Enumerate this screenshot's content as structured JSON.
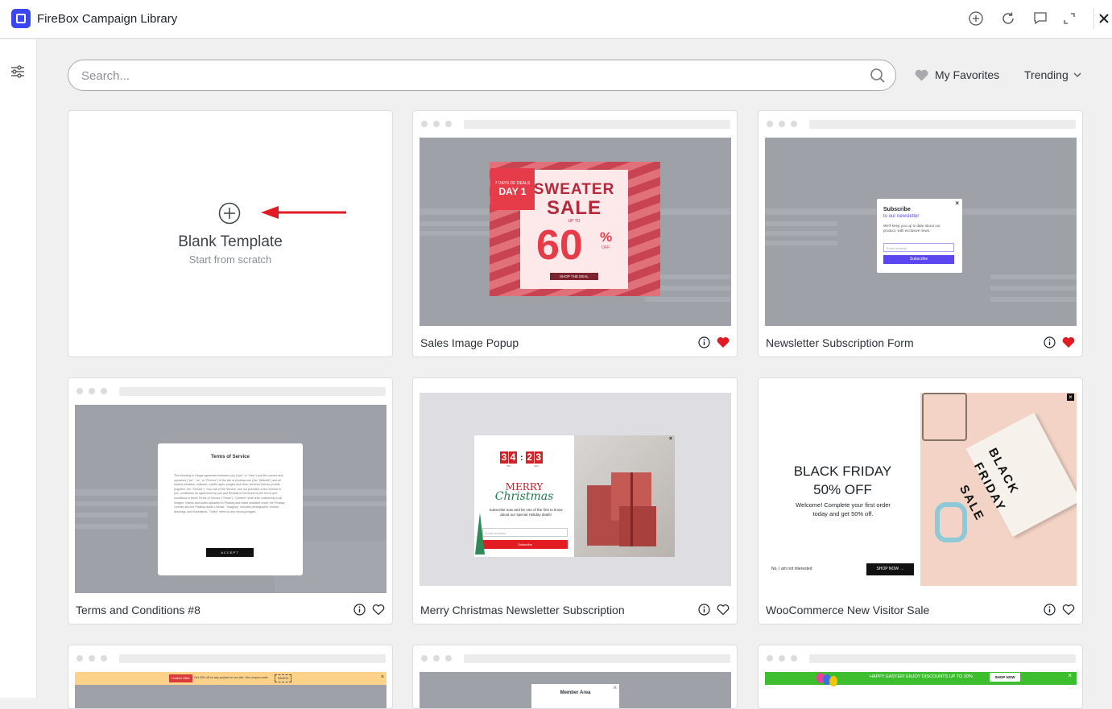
{
  "app": {
    "title": "FireBox Campaign Library"
  },
  "toolbar": {
    "icons": [
      "add-circle-icon",
      "refresh-icon",
      "comment-icon",
      "expand-icon",
      "close-icon"
    ]
  },
  "search": {
    "placeholder": "Search..."
  },
  "favorites": {
    "label": "My Favorites"
  },
  "sort": {
    "label": "Trending"
  },
  "blank": {
    "title": "Blank Template",
    "subtitle": "Start from scratch"
  },
  "cards": [
    {
      "name": "Sales Image Popup",
      "favorite": true
    },
    {
      "name": "Newsletter Subscription Form",
      "favorite": true
    },
    {
      "name": "Terms and Conditions #8",
      "favorite": false
    },
    {
      "name": "Merry Christmas Newsletter Subscription",
      "favorite": false
    },
    {
      "name": "WooCommerce New Visitor Sale",
      "favorite": false
    }
  ],
  "previews": {
    "sale": {
      "ribbon_top": "7 DAYS OF DEALS",
      "ribbon_day": "DAY 1",
      "word1": "SWEATER",
      "word2": "SALE",
      "upto": "UP TO",
      "pct": "60",
      "pct_sign": "%",
      "off": "OFF",
      "cta": "SHOP THE DEAL"
    },
    "newsletter": {
      "title": "Subscribe",
      "subtitle": "to our newsletter",
      "text": "We'll keep you up to date about our product, with exclusive news.",
      "input": "Email address",
      "button": "Subscribe"
    },
    "tos": {
      "title": "Terms of Service",
      "body": "The following is a legal agreement between you (\"you\" or \"User\") and the owners and operators (\"we\", \"us\", or \"Firebox\") of the site at pixabay.com (the \"Website\") and all related websites, software, mobile apps, plugins and other services that we provide (together, the \"Service\"). Your use of the Service, and our provision of the Service to you, constitutes an agreement by you and Pixabay to be bound by the terms and conditions in these Terms of Service (\"Terms\"). \"Content\" shall refer collectively to all Images, Videos and Audio uploaded to Pixabay and made available under the Pixabay License and the Pixabay Audio License. \"Image(s)\" includes photographs, vectors, drawings, and illustrations. \"Video\" refers to any moving images.",
      "button": "ACCEPT"
    },
    "xmas": {
      "h1": "3",
      "h2": "4",
      "m1": "2",
      "m2": "3",
      "unit1": "MIN",
      "unit2": "SEC",
      "merry": "MERRY",
      "christmas": "Christmas",
      "text": "Subscribe now and be one of the first to know about our special Holiday deals!",
      "input": "Email address",
      "button": "Subscribe"
    },
    "bf": {
      "title1": "BLACK FRIDAY",
      "title2": "50% OFF",
      "text": "Welcome! Complete your first order today and get 50% off.",
      "no": "No, I am not interested",
      "cta": "SHOP NOW →",
      "sign1": "BLACK",
      "sign2": "FRIDAY",
      "sign3": "SALE"
    },
    "bar1": {
      "tag": "Limited Offer",
      "text": "Get 20% off on any product on our site. Use coupon code:",
      "code": "SAVE20"
    },
    "member": {
      "title": "Member Area"
    },
    "easter": {
      "text": "HAPPY EASTER! ENJOY DISCOUNTS UP TO 20%",
      "button": "SHOP NOW"
    }
  }
}
